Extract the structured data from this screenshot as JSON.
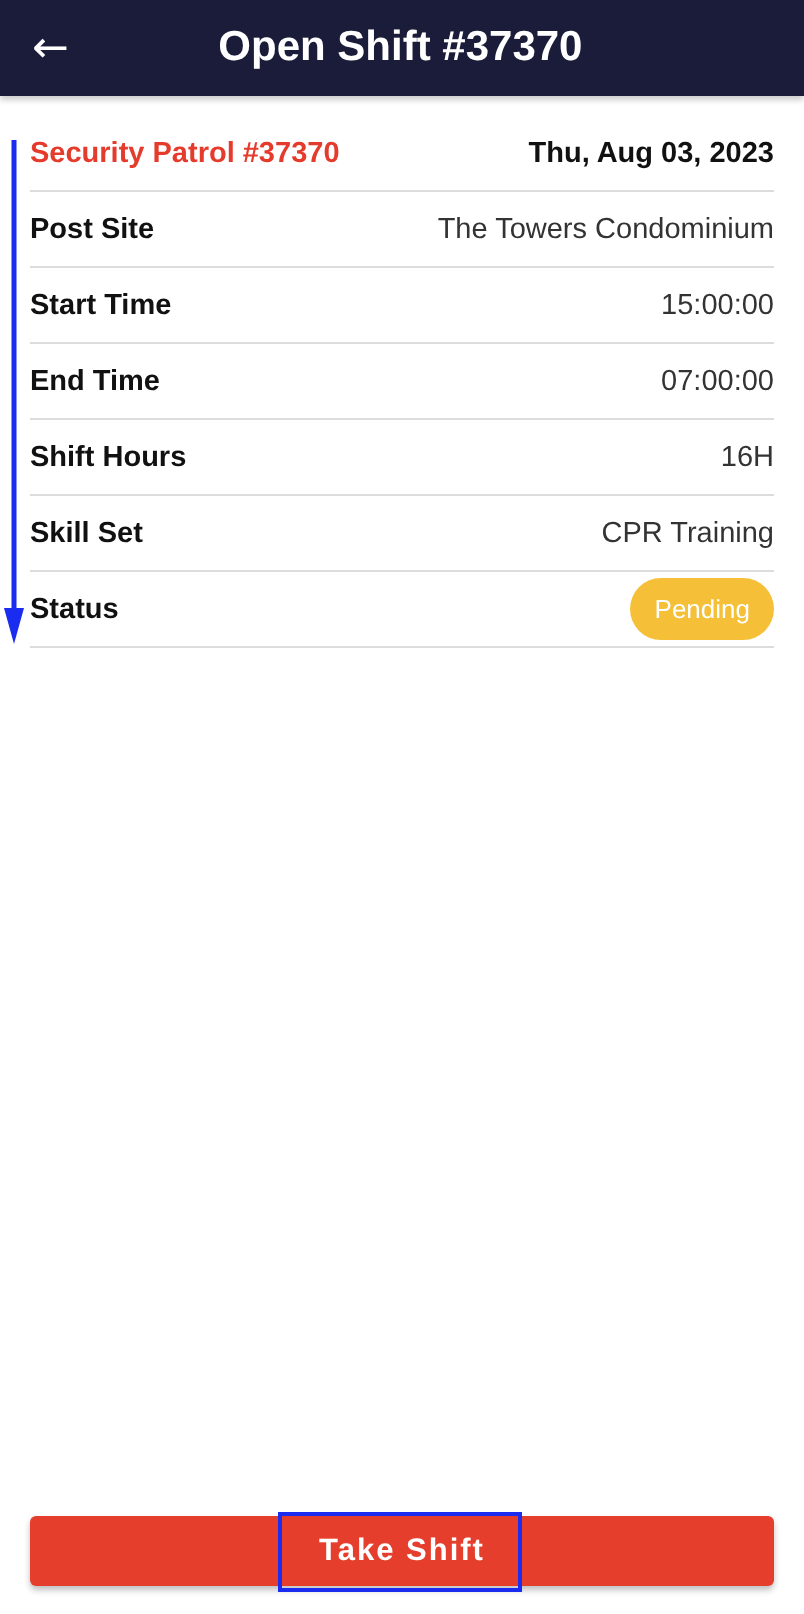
{
  "header": {
    "back_icon": "←",
    "title": "Open Shift #37370"
  },
  "shift": {
    "name": "Security Patrol #37370",
    "date": "Thu, Aug 03, 2023"
  },
  "details": [
    {
      "label": "Post Site",
      "value": "The Towers Condominium",
      "kind": "text"
    },
    {
      "label": "Start Time",
      "value": "15:00:00",
      "kind": "text"
    },
    {
      "label": "End Time",
      "value": "07:00:00",
      "kind": "text"
    },
    {
      "label": "Shift Hours",
      "value": "16H",
      "kind": "text"
    },
    {
      "label": "Skill Set",
      "value": "CPR Training",
      "kind": "text"
    },
    {
      "label": "Status",
      "value": "Pending",
      "kind": "badge",
      "color": "#f5c038"
    }
  ],
  "action_button": "Take Shift"
}
